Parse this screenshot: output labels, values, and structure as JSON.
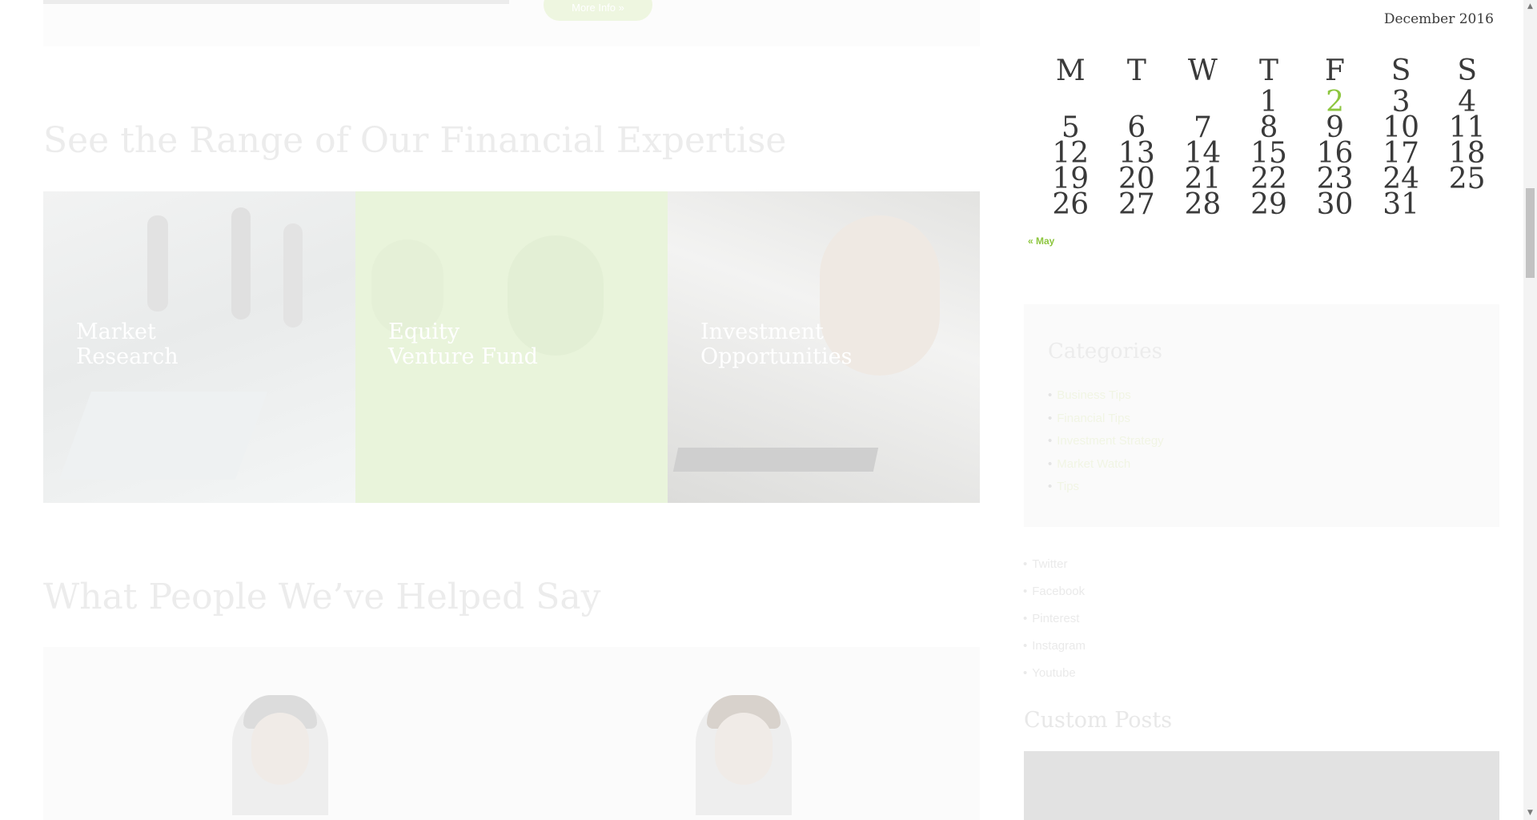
{
  "main": {
    "more_info_label": "More Info »",
    "expertise_title": "See the Range of Our Financial Expertise",
    "services": [
      {
        "line1": "Market",
        "line2": "Research"
      },
      {
        "line1": "Equity",
        "line2": "Venture Fund"
      },
      {
        "line1": "Investment",
        "line2": "Opportunities"
      }
    ],
    "testimonials_title": "What People We’ve Helped Say"
  },
  "calendar": {
    "caption": "December 2016",
    "weekdays": [
      "M",
      "T",
      "W",
      "T",
      "F",
      "S",
      "S"
    ],
    "weeks": [
      [
        "",
        "",
        "",
        "1",
        "2",
        "3",
        "4"
      ],
      [
        "5",
        "6",
        "7",
        "8",
        "9",
        "10",
        "11"
      ],
      [
        "12",
        "13",
        "14",
        "15",
        "16",
        "17",
        "18"
      ],
      [
        "19",
        "20",
        "21",
        "22",
        "23",
        "24",
        "25"
      ],
      [
        "26",
        "27",
        "28",
        "29",
        "30",
        "31",
        ""
      ]
    ],
    "today": "2",
    "prev_link": "« May"
  },
  "categories": {
    "title": "Categories",
    "items": [
      "Business Tips",
      "Financial Tips",
      "Investment Strategy",
      "Market Watch",
      "Tips"
    ]
  },
  "social": [
    "Twitter",
    "Facebook",
    "Pinterest",
    "Instagram",
    "Youtube"
  ],
  "custom_posts": {
    "title": "Custom Posts"
  },
  "colors": {
    "accent": "#8dc63f",
    "faded_title": "#ececec"
  }
}
